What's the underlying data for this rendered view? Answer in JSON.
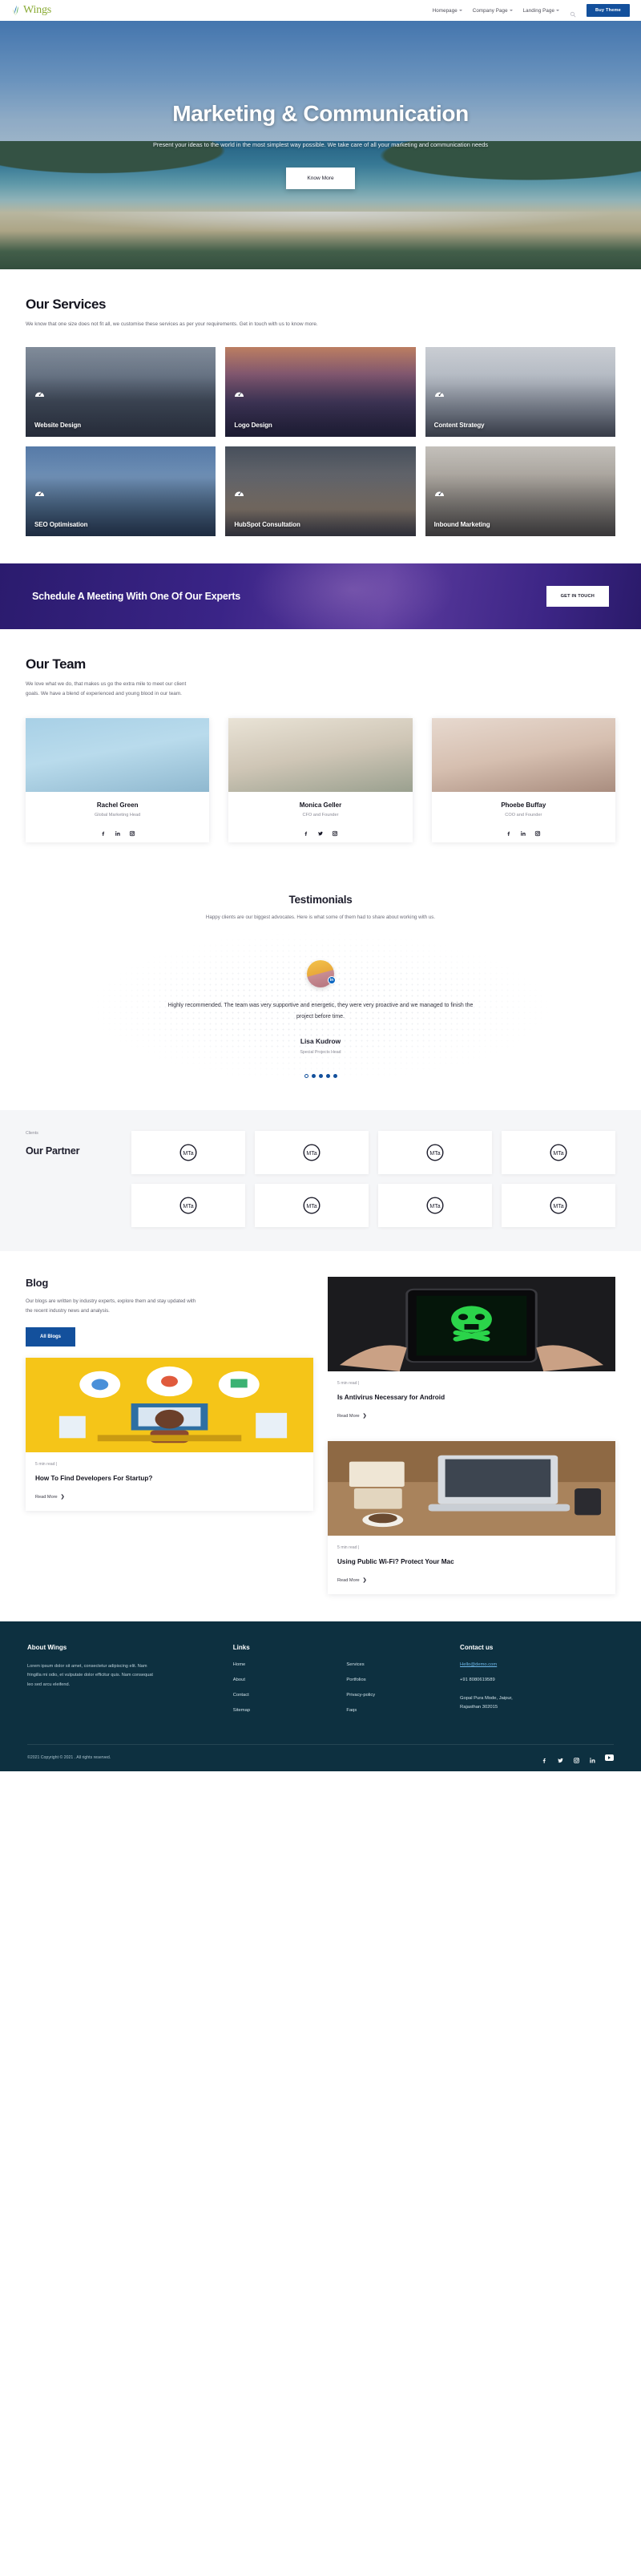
{
  "header": {
    "logo_text": "Wings",
    "nav": [
      {
        "label": "Homepage",
        "has_caret": true
      },
      {
        "label": "Company Page",
        "has_caret": true
      },
      {
        "label": "Landing Page",
        "has_caret": true
      }
    ],
    "search_icon": "search-icon",
    "buy_label": "Buy Theme",
    "accent_blue": "#13509c"
  },
  "hero": {
    "title": "Marketing & Communication",
    "subtitle": "Present your ideas to the world in the most simplest way possible. We take care of all your marketing and communication needs",
    "button": "Know More"
  },
  "services": {
    "title": "Our Services",
    "subtitle": "We know that one size does not fit all, we customise these services as per your requirements. Get in touch with us to know more.",
    "cards": [
      {
        "label": "Website Design",
        "icon": "gauge-icon"
      },
      {
        "label": "Logo Design",
        "icon": "gauge-icon"
      },
      {
        "label": "Content Strategy",
        "icon": "gauge-icon"
      },
      {
        "label": "SEO Optimisation",
        "icon": "gauge-icon"
      },
      {
        "label": "HubSpot Consultation",
        "icon": "gauge-icon"
      },
      {
        "label": "Inbound Marketing",
        "icon": "gauge-icon"
      }
    ]
  },
  "cta": {
    "title": "Schedule A Meeting With One Of Our Experts",
    "button": "GET IN TOUCH"
  },
  "team": {
    "title": "Our Team",
    "subtitle": "We love what we do, that makes us go the extra mile to meet our client goals. We have a blend of experienced and young blood in our team.",
    "members": [
      {
        "name": "Rachel Green",
        "role": "Global Marketing Head",
        "socials": [
          "facebook-icon",
          "linkedin-icon",
          "instagram-icon"
        ]
      },
      {
        "name": "Monica Geller",
        "role": "CFO and Founder",
        "socials": [
          "facebook-icon",
          "twitter-icon",
          "instagram-icon"
        ]
      },
      {
        "name": "Phoebe Buffay",
        "role": "COO and Founder",
        "socials": [
          "facebook-icon",
          "linkedin-icon",
          "instagram-icon"
        ]
      }
    ]
  },
  "testimonials": {
    "title": "Testimonials",
    "subtitle": "Happy clients are our biggest advocates. Here is what some of them had to share about working with us.",
    "quote": "Highly recommended. The team was very supportive and energetic, they were very proactive and we managed to finish the project before time.",
    "name": "Lisa Kudrow",
    "role": "Special Projects Head",
    "badge": "in",
    "dots_total": 5,
    "dots_active_index": 0
  },
  "partners": {
    "eyebrow": "Clients",
    "title": "Our Partner",
    "logo_text": "MTa",
    "count": 8
  },
  "blog": {
    "title": "Blog",
    "description": "Our blogs are written by industry experts, explore them and stay updated with the recent industry news and analysis.",
    "button": "All Blogs",
    "read_more": "Read More",
    "posts": [
      {
        "meta": "5 min read |",
        "title": "Is Antivirus Necessary for Android",
        "image": "phone-skull-image"
      },
      {
        "meta": "5 min read |",
        "title": "How To Find Developers For Startup?",
        "image": "illustration-image"
      },
      {
        "meta": "5 min read |",
        "title": "Using Public Wi-Fi? Protect Your Mac",
        "image": "laptop-desk-image"
      }
    ]
  },
  "footer": {
    "about_heading": "About Wings",
    "about_text": "Lorem ipsum dolor sit amet, consectetur adipiscing elit. Nam fringilla mi odio, et vulputate dolor efficitur quis. Nam consequat leo sed arcu eleifend.",
    "links_heading": "Links",
    "links_col1": [
      "Home",
      "About",
      "Contact",
      "Sitemap"
    ],
    "links_col2": [
      "Services",
      "Portfolios",
      "Privacy-policy",
      "Faqs"
    ],
    "contact_heading": "Contact us",
    "email": "Hello@demo.com",
    "phone": "+91 8080619589",
    "address_line1": "Gopal Pura Mode, Jaipur,",
    "address_line2": "Rajasthan 302015",
    "copyright": "©2021 Copyright © 2021 . All rights reserved.",
    "socials": [
      "facebook-icon",
      "twitter-icon",
      "instagram-icon",
      "linkedin-icon",
      "youtube-icon"
    ]
  }
}
